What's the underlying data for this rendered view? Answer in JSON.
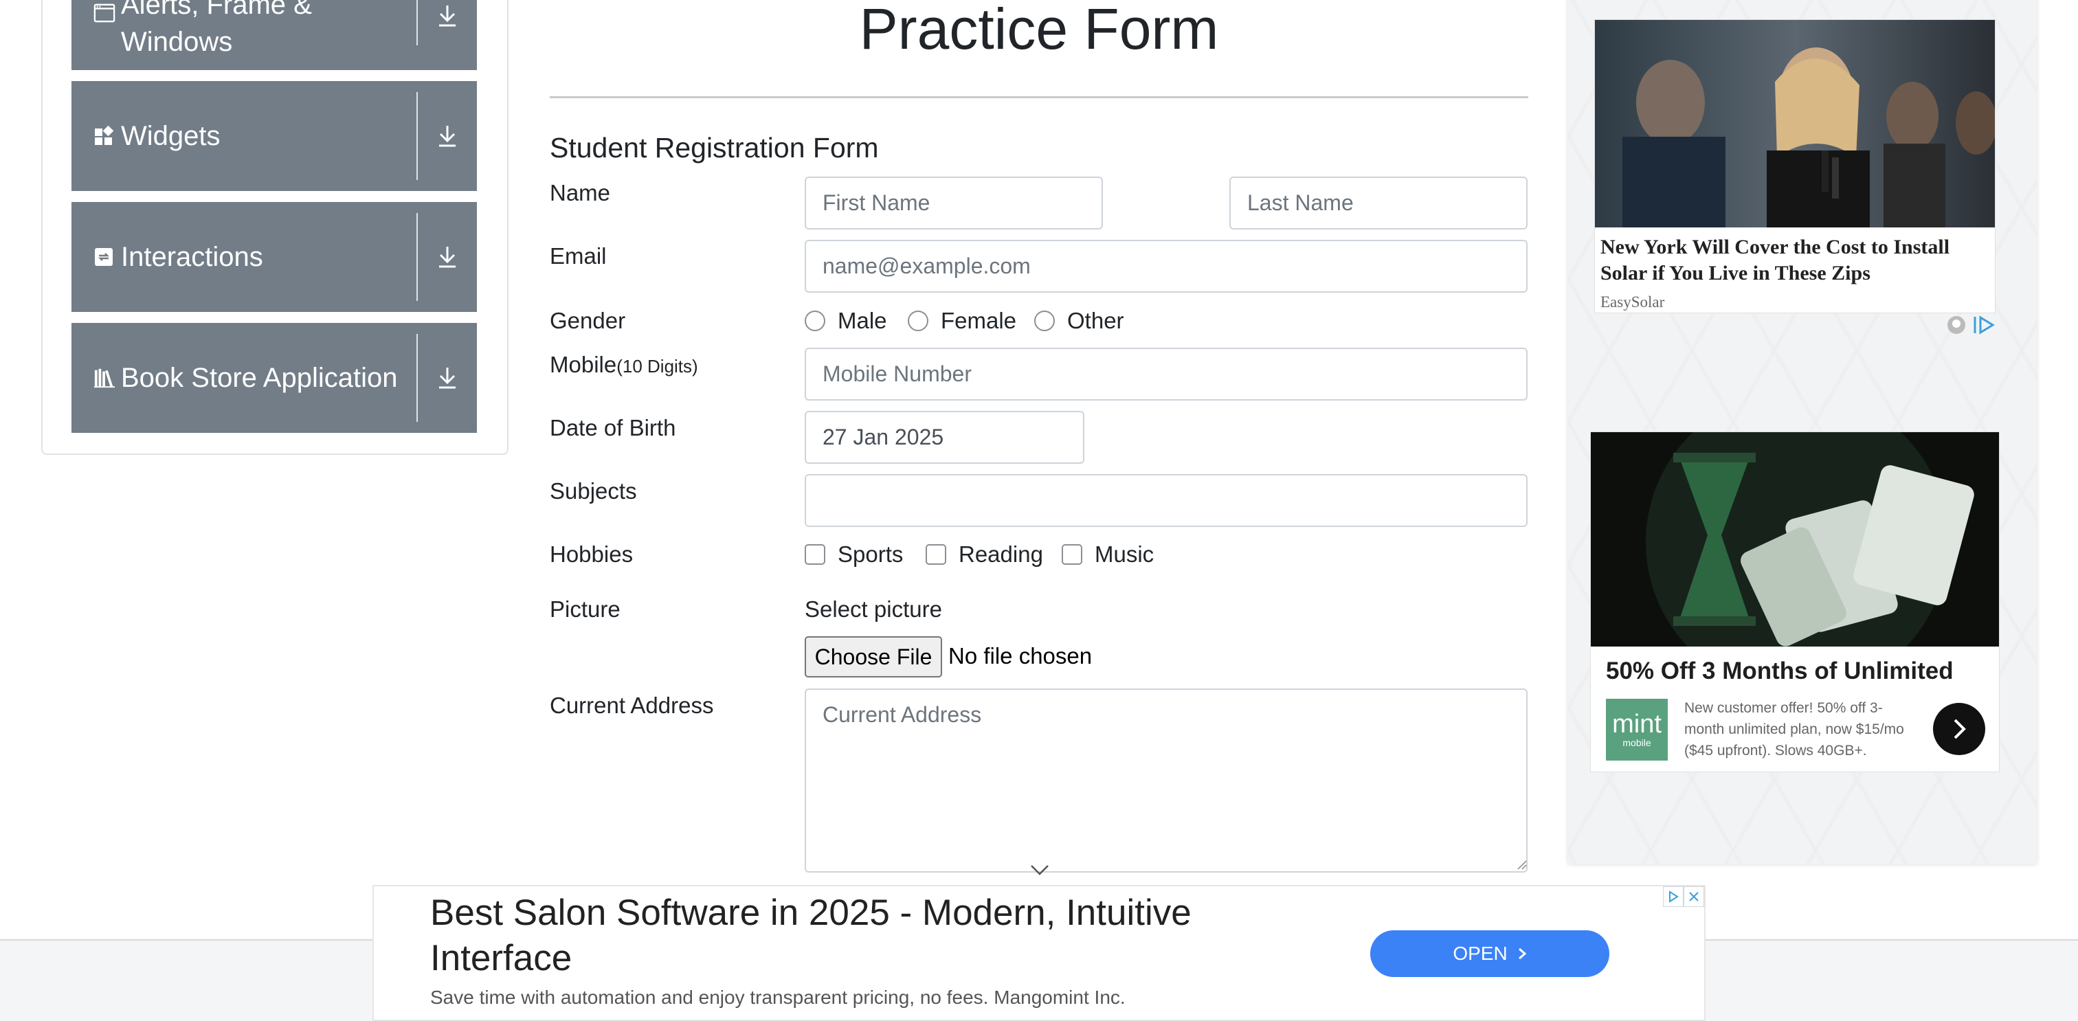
{
  "sidebar": {
    "groups": [
      {
        "label_line1": "Alerts, Frame &",
        "label_line2": "Windows",
        "icon": "window-icon"
      },
      {
        "label": "Widgets",
        "icon": "widgets-icon"
      },
      {
        "label": "Interactions",
        "icon": "interactions-icon"
      },
      {
        "label": "Book Store Application",
        "icon": "books-icon"
      }
    ]
  },
  "main": {
    "title": "Practice Form",
    "form_title": "Student Registration Form",
    "labels": {
      "name": "Name",
      "email": "Email",
      "gender": "Gender",
      "mobile": "Mobile",
      "mobile_hint": "(10 Digits)",
      "dob": "Date of Birth",
      "subjects": "Subjects",
      "hobbies": "Hobbies",
      "picture": "Picture",
      "address": "Current Address"
    },
    "placeholders": {
      "first_name": "First Name",
      "last_name": "Last Name",
      "email": "name@example.com",
      "mobile": "Mobile Number",
      "address": "Current Address"
    },
    "dob_value": "27 Jan 2025",
    "gender_options": [
      "Male",
      "Female",
      "Other"
    ],
    "hobby_options": [
      "Sports",
      "Reading",
      "Music"
    ],
    "picture": {
      "select_label": "Select picture",
      "button": "Choose File",
      "status": "No file chosen"
    }
  },
  "ads": {
    "ad1": {
      "headline": "New York Will Cover the Cost to Install Solar if You Live in These Zips",
      "source": "EasySolar"
    },
    "ad2": {
      "title": "50% Off 3 Months of Unlimited",
      "body": "New customer offer! 50% off 3-month unlimited plan, now $15/mo ($45 upfront). Slows 40GB+.",
      "logo_top": "mint",
      "logo_bottom": "mobile"
    },
    "bottom": {
      "headline": "Best Salon Software in 2025 - Modern, Intuitive Interface",
      "subtext": "Save time with automation and enjoy transparent pricing, no fees. Mangomint Inc.",
      "button": "OPEN"
    }
  },
  "colors": {
    "sidebar_header": "#727d87",
    "open_button": "#3b82f6",
    "mint_green": "#5aa17f"
  }
}
